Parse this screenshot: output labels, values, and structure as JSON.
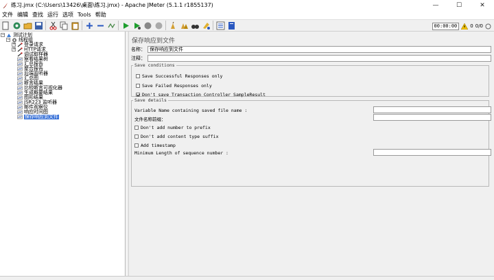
{
  "window": {
    "title": "练习.jmx (C:\\Users\\13426\\桌面\\练习.jmx) - Apache JMeter (5.1.1 r1855137)",
    "minimize": "—",
    "maximize": "☐",
    "close": "✕"
  },
  "menu": [
    "文件",
    "编辑",
    "查找",
    "运行",
    "选项",
    "Tools",
    "帮助"
  ],
  "toolbar": {
    "timer": "00:00:00",
    "warning_count": "0",
    "threads": "0/0"
  },
  "tree": {
    "items": [
      {
        "label": "测试计划",
        "icon": "test-plan-icon"
      },
      {
        "label": "线程组",
        "icon": "thread-group-icon"
      },
      {
        "label": "登录请求",
        "icon": "sampler-icon"
      },
      {
        "label": "HTTP请求",
        "icon": "sampler-icon"
      },
      {
        "label": "调试取样器",
        "icon": "sampler-icon"
      },
      {
        "label": "察看结果树",
        "icon": "listener-icon"
      },
      {
        "label": "汇总报告",
        "icon": "listener-icon"
      },
      {
        "label": "聚合报告",
        "icon": "listener-icon"
      },
      {
        "label": "后端监听器",
        "icon": "listener-icon"
      },
      {
        "label": "汇总图",
        "icon": "listener-icon"
      },
      {
        "label": "断言结果",
        "icon": "listener-icon"
      },
      {
        "label": "比较断言可视化器",
        "icon": "listener-icon"
      },
      {
        "label": "生成概要结果",
        "icon": "listener-icon"
      },
      {
        "label": "图形结果",
        "icon": "listener-icon"
      },
      {
        "label": "JSR223 监听器",
        "icon": "listener-icon"
      },
      {
        "label": "邮件观察仪",
        "icon": "listener-icon"
      },
      {
        "label": "响应时间图",
        "icon": "listener-icon"
      },
      {
        "label": "保存响应到文件",
        "icon": "listener-icon"
      }
    ]
  },
  "panel": {
    "title": "保存响应到文件",
    "name_label": "名称：",
    "name_value": "保存响应到文件",
    "comment_label": "注释：",
    "comment_value": "",
    "save_conditions": {
      "legend": "Save conditions",
      "options": [
        {
          "label": "Save Successful Responses only",
          "checked": false
        },
        {
          "label": "Save Failed Responses only",
          "checked": false
        },
        {
          "label": "Don't save Transaction Controller SampleResult",
          "checked": true
        }
      ]
    },
    "save_details": {
      "legend": "Save details",
      "variable_name_label": "Variable Name containing saved file name :",
      "prefix_label": "文件名称前缀：",
      "dont_add_number": "Don't add number to prefix",
      "dont_add_content_type": "Don't add content type suffix",
      "add_timestamp": "Add timestamp",
      "min_length_label": "Minimum Length of sequence number :"
    }
  }
}
